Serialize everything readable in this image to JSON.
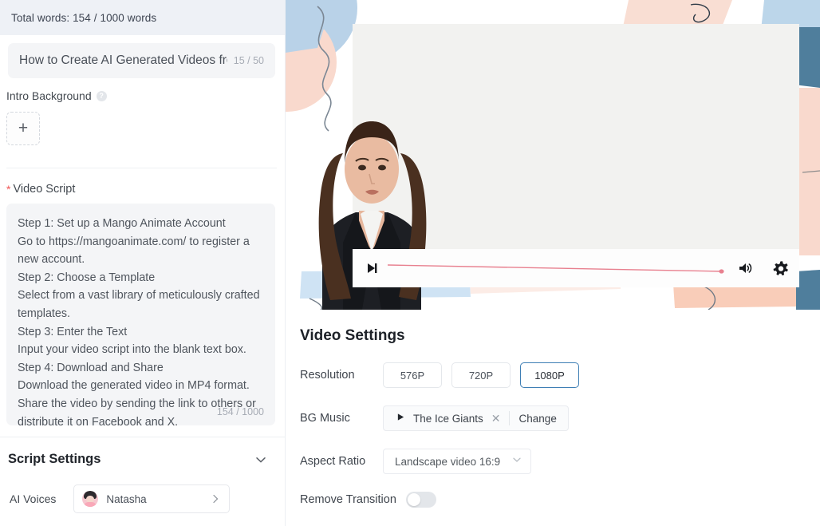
{
  "left": {
    "words_bar": "Total words: 154 / 1000 words",
    "title": {
      "value": "How to Create AI Generated Videos fror",
      "counter": "15 / 50"
    },
    "intro_background": {
      "label": "Intro Background",
      "help_icon": "question-circle-icon",
      "add_label": "+"
    },
    "video_script": {
      "required_mark": "*",
      "label": "Video Script",
      "text": "Step 1: Set up a Mango Animate Account\nGo to https://mangoanimate.com/ to register a new account.\nStep 2: Choose a Template\nSelect from a vast library of meticulously crafted templates.\nStep 3: Enter the Text\nInput your video script into the blank text box.\nStep 4: Download and Share\nDownload the generated video in MP4 format. Share the video by sending the link to others or distribute it on Facebook and X.",
      "counter": "154 / 1000"
    },
    "script_settings": {
      "title": "Script Settings",
      "collapse_icon": "chevron-down-icon",
      "ai_voices_label": "AI Voices",
      "voice_name": "Natasha",
      "voice_chevron_icon": "chevron-right-icon"
    }
  },
  "player": {
    "skip_icon": "skip-next-icon",
    "volume_icon": "volume-icon",
    "settings_icon": "gear-icon",
    "progress_color": "#e8808f"
  },
  "video_settings": {
    "title": "Video Settings",
    "resolution": {
      "label": "Resolution",
      "options": [
        "576P",
        "720P",
        "1080P"
      ],
      "selected": "1080P",
      "selected_color": "#3f7fb5"
    },
    "bg_music": {
      "label": "BG Music",
      "play_icon": "play-icon",
      "track": "The Ice Giants",
      "clear_icon": "close-icon",
      "change_label": "Change"
    },
    "aspect_ratio": {
      "label": "Aspect Ratio",
      "value": "Landscape video 16:9",
      "chevron_icon": "chevron-down-icon"
    },
    "remove_transition": {
      "label": "Remove Transition",
      "enabled": false
    }
  }
}
